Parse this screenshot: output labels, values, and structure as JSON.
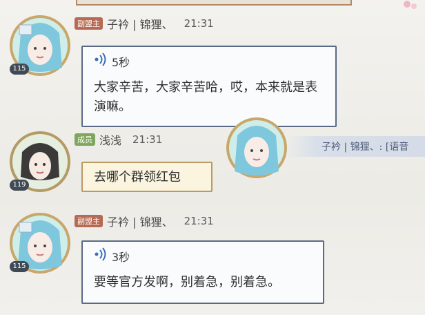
{
  "messages": [
    {
      "role": "副盟主",
      "nickname": "子衿 | 锦狸、",
      "time": "21:31",
      "level": "115",
      "voice_duration": "5秒",
      "text": "大家辛苦，大家辛苦哈，哎，本来就是表演嘛。"
    },
    {
      "role": "成员",
      "nickname": "浅浅",
      "time": "21:31",
      "level": "119",
      "text": "去哪个群领红包"
    },
    {
      "role": "副盟主",
      "nickname": "子衿 | 锦狸、",
      "time": "21:31",
      "level": "115",
      "voice_duration": "3秒",
      "text": "要等官方发啊，别着急，别着急。"
    }
  ],
  "overlay": {
    "text": "子衿 | 锦狸、: [语音"
  },
  "colors": {
    "deputy_badge": "#b56a54",
    "member_badge": "#7fa55e",
    "bubble_border": "#5a6a86",
    "yellow_bubble": "#fbf4df"
  }
}
